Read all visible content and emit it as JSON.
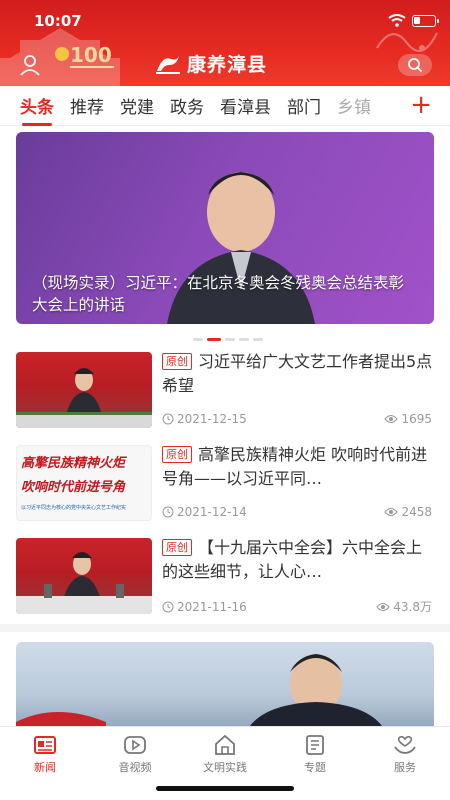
{
  "status_bar": {
    "time": "10:07"
  },
  "header": {
    "title": "康养漳县",
    "icons": [
      "user-icon",
      "party-100-logo",
      "brand-logo-icon",
      "search-icon"
    ]
  },
  "tabs": [
    "头条",
    "推荐",
    "党建",
    "政务",
    "看漳县",
    "部门",
    "乡镇"
  ],
  "active_tab": "头条",
  "banner": {
    "caption": "（现场实录）习近平：在北京冬奥会冬残奥会总结表彰大会上的讲话",
    "slide_count": 5,
    "active_slide": 1
  },
  "news": [
    {
      "badge": "原创",
      "title": "习近平给广大文艺工作者提出5点希望",
      "date": "2021-12-15",
      "views": "1695"
    },
    {
      "badge": "原创",
      "title": "高擎民族精神火炬 吹响时代前进号角——以习近平同…",
      "date": "2021-12-14",
      "views": "2458",
      "thumb_text": {
        "line1": "高擎民族精神火炬",
        "line2": "吹响时代前进号角",
        "line3": "以习近平同志为核心的党中央关心文艺工作纪实"
      }
    },
    {
      "badge": "原创",
      "title": "【十九届六中全会】六中全会上的这些细节，让人心…",
      "date": "2021-11-16",
      "views": "43.8万"
    }
  ],
  "bottom_nav": [
    {
      "label": "新闻",
      "icon": "news-icon",
      "active": true
    },
    {
      "label": "音视频",
      "icon": "video-icon",
      "active": false
    },
    {
      "label": "文明实践",
      "icon": "civilization-icon",
      "active": false
    },
    {
      "label": "专题",
      "icon": "topic-icon",
      "active": false
    },
    {
      "label": "服务",
      "icon": "service-icon",
      "active": false
    }
  ],
  "colors": {
    "brand_red": "#e22a23",
    "header_red": "#d21d1d"
  }
}
